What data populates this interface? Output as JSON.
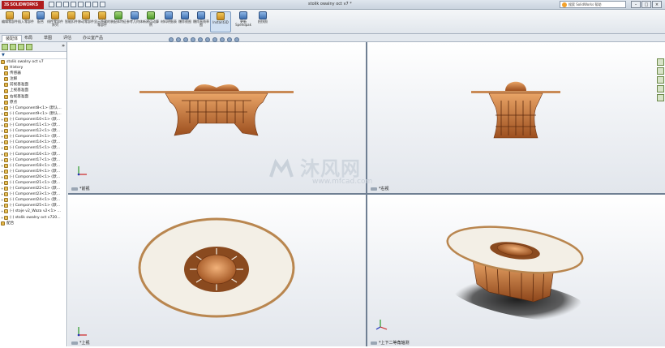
{
  "app": {
    "logo": "3S SOLIDWORKS",
    "doc_title": "stolik owalny oct v7 *",
    "help_placeholder": "搜索 SolidWorks 帮助"
  },
  "window_buttons": [
    "–",
    "□",
    "×"
  ],
  "toolbar": {
    "buttons": [
      "编辑零部件",
      "插入零部件",
      "配合",
      "线性零部件阵列",
      "智能扣件",
      "移动零部件",
      "显示隐藏的零部件",
      "装配体特征",
      "参考几何体",
      "新建运动算例",
      "材料明细表",
      "爆炸视图",
      "爆炸直线草图",
      "Instant3D",
      "更新 Speedpak",
      "拍快照"
    ]
  },
  "tabs": [
    "装配体",
    "布局",
    "草图",
    "评估",
    "办公室产品"
  ],
  "tree": {
    "filter": "▼",
    "root": "stolik owalny oct v7",
    "items": [
      "History",
      "传感器",
      "注解",
      "前视基准面",
      "上视基准面",
      "右视基准面",
      "原点",
      "(-) Component8<1> (默认...",
      "(-) Component9<1> (默认...",
      "(-) Component10<1> (默...",
      "(-) Component11<1> (默...",
      "(-) Component12<1> (默...",
      "(-) Component13<1> (默...",
      "(-) Component14<1> (默...",
      "(-) Component15<1> (默...",
      "(-) Component16<1> (默...",
      "(-) Component17<1> (默...",
      "(-) Component18<1> (默...",
      "(-) Component19<1> (默...",
      "(-) Component20<1> (默...",
      "(-) Component21<1> (默...",
      "(-) Component22<1> (默...",
      "(-) Component23<1> (默...",
      "(-) Component24<1> (默...",
      "(-) Component25<1> (默...",
      "(-) stoje v2_Waza v2<1> ...",
      "(-) stolik owalny oct v720...",
      "配合"
    ]
  },
  "viewports": {
    "front": "*前视",
    "right": "*右视",
    "top": "*上视",
    "iso": "*上下二等角轴测"
  },
  "watermark": {
    "main": "沐风网",
    "sub": "www.mfcad.com"
  },
  "colors": {
    "wood": "#b5652b",
    "wood_light": "#e29a5a",
    "tabletop": "#f3efe6",
    "shadow": "#2a2a2a"
  }
}
